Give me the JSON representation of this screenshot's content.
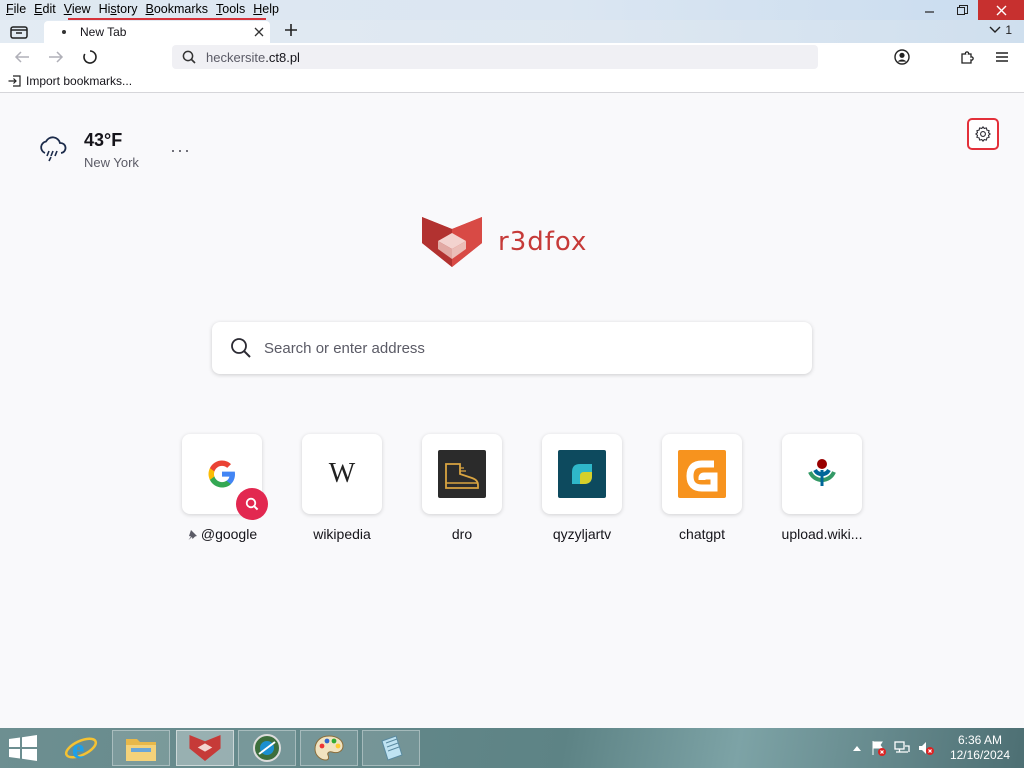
{
  "menu": {
    "items": [
      "File",
      "Edit",
      "View",
      "History",
      "Bookmarks",
      "Tools",
      "Help"
    ],
    "underlined": [
      "F",
      "E",
      "V",
      "s",
      "B",
      "T",
      "H"
    ]
  },
  "tab": {
    "title": "New Tab",
    "tab_count": "1"
  },
  "nav": {
    "url_host": "heckersite",
    "url_domain": ".ct8.pl"
  },
  "bookmarks": {
    "import_label": "Import bookmarks..."
  },
  "weather": {
    "temp": "43°F",
    "city": "New York",
    "menu_label": "···"
  },
  "brand": {
    "name": "r3dfox",
    "accent": "#c63a38"
  },
  "search": {
    "placeholder": "Search or enter address"
  },
  "shortcuts": [
    {
      "label": "@google",
      "pinned": true,
      "icon": "google-icon"
    },
    {
      "label": "wikipedia",
      "icon": "wikipedia-icon"
    },
    {
      "label": "dro",
      "icon": "boot-icon"
    },
    {
      "label": "qyzyljartv",
      "icon": "qyzyljar-icon"
    },
    {
      "label": "chatgpt",
      "icon": "chatgpt-icon"
    },
    {
      "label": "upload.wiki...",
      "icon": "wikimedia-icon"
    }
  ],
  "taskbar": {
    "apps": [
      "internet-explorer",
      "file-explorer",
      "r3dfox",
      "network-app",
      "paint",
      "notepad"
    ],
    "time": "6:36 AM",
    "date": "12/16/2024"
  },
  "colors": {
    "focus_ring": "#e3303a",
    "badge": "#e22850",
    "close_button": "#c7302f"
  }
}
